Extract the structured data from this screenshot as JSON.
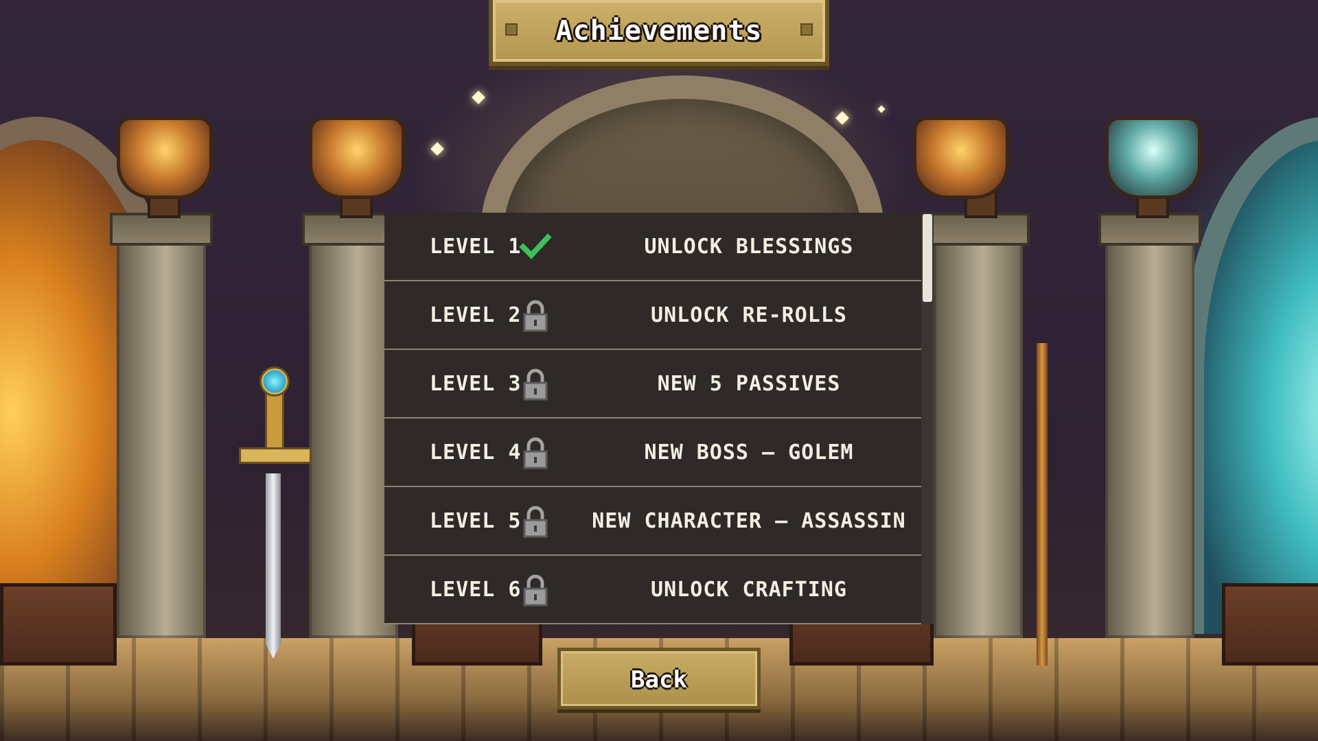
{
  "screen": {
    "title": "Achievements"
  },
  "achievements": [
    {
      "level": "LEVEL 1",
      "reward": "UNLOCK BLESSINGS",
      "status": "unlocked",
      "status_icon": "check-icon"
    },
    {
      "level": "LEVEL 2",
      "reward": "UNLOCK RE-ROLLS",
      "status": "locked",
      "status_icon": "lock-icon"
    },
    {
      "level": "LEVEL 3",
      "reward": "NEW 5 PASSIVES",
      "status": "locked",
      "status_icon": "lock-icon"
    },
    {
      "level": "LEVEL 4",
      "reward": "NEW BOSS – GOLEM",
      "status": "locked",
      "status_icon": "lock-icon"
    },
    {
      "level": "LEVEL 5",
      "reward": "NEW CHARACTER – ASSASSIN",
      "status": "locked",
      "status_icon": "lock-icon"
    },
    {
      "level": "LEVEL 6",
      "reward": "UNLOCK CRAFTING",
      "status": "locked",
      "status_icon": "lock-icon"
    }
  ],
  "buttons": {
    "back_label": "Back"
  },
  "colors": {
    "banner_gold": "#c4a85f",
    "panel_dark": "#2f2927",
    "check_green": "#3fbf5a",
    "lock_grey": "#9b9b9b",
    "text_light": "#f4efe4"
  }
}
